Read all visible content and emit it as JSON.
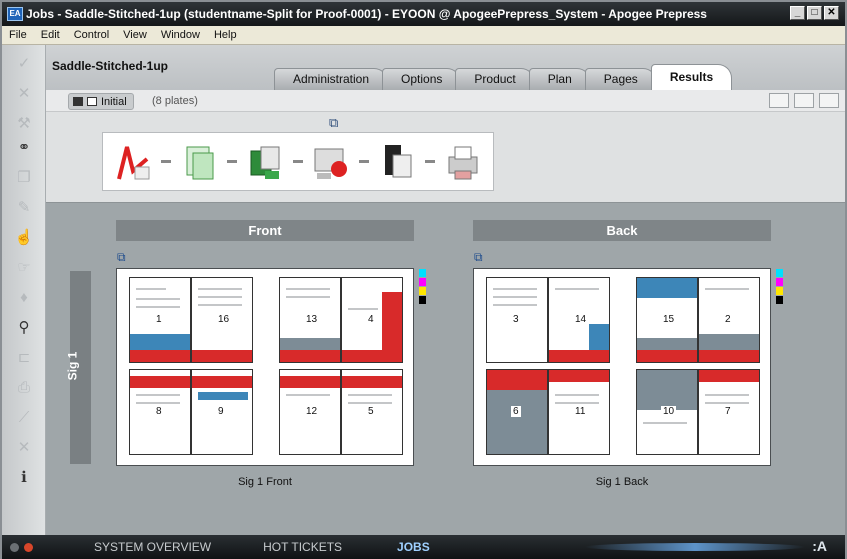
{
  "window": {
    "title": "Jobs - Saddle-Stitched-1up (studentname-Split for Proof-0001) - EYOON @ ApogeePrepress_System - Apogee Prepress",
    "app_icon": "EA",
    "controls": [
      "minimize",
      "maximize",
      "close"
    ]
  },
  "menu": [
    "File",
    "Edit",
    "Control",
    "View",
    "Window",
    "Help"
  ],
  "job": {
    "name": "Saddle-Stitched-1up"
  },
  "tabs": [
    {
      "label": "Administration",
      "active": false
    },
    {
      "label": "Options",
      "active": false
    },
    {
      "label": "Product",
      "active": false
    },
    {
      "label": "Plan",
      "active": false
    },
    {
      "label": "Pages",
      "active": false
    },
    {
      "label": "Results",
      "active": true
    }
  ],
  "toolbar": {
    "view_label": "Initial",
    "plates_count": "(8 plates)"
  },
  "workflow_steps": [
    "pdf-step-icon",
    "prepare-step-icon",
    "imposition-step-icon",
    "proof-step-icon",
    "render-step-icon",
    "output-step-icon"
  ],
  "sides": {
    "front": {
      "header": "Front",
      "caption": "Sig 1 Front",
      "top_pages": [
        "1",
        "16",
        "13",
        "4"
      ],
      "bottom_pages": [
        "8",
        "9",
        "12",
        "5"
      ]
    },
    "back": {
      "header": "Back",
      "caption": "Sig 1 Back",
      "top_pages": [
        "3",
        "14",
        "15",
        "2"
      ],
      "bottom_pages": [
        "6",
        "11",
        "10",
        "7"
      ]
    }
  },
  "signature": {
    "label": "Sig 1"
  },
  "bottom_nav": [
    {
      "label": "SYSTEM OVERVIEW",
      "active": false
    },
    {
      "label": "HOT TICKETS",
      "active": false
    },
    {
      "label": "JOBS",
      "active": true
    }
  ],
  "brand_mark": ":A",
  "colors": {
    "accent_red": "#d82a2a",
    "accent_blue": "#3d86b8",
    "active_nav": "#9fd0ff"
  }
}
